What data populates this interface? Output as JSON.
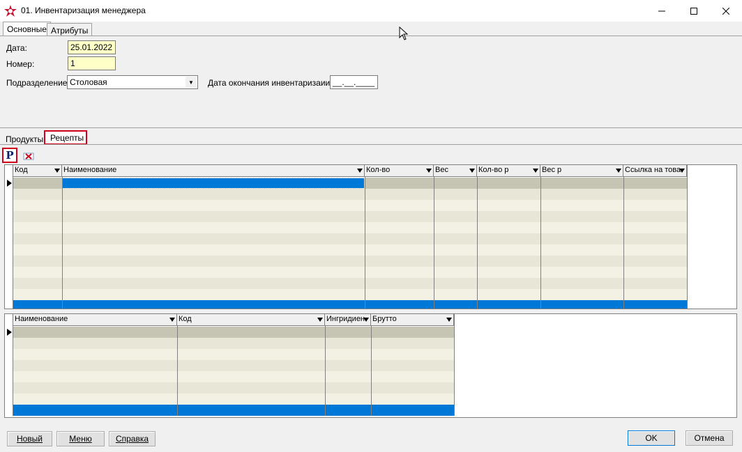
{
  "window": {
    "title": "01. Инвентаризация менеджера"
  },
  "top_tabs": [
    "Основные",
    "Атрибуты"
  ],
  "form": {
    "date_label": "Дата:",
    "date_value": "25.01.2022",
    "number_label": "Номер:",
    "number_value": "1",
    "division_label": "Подразделение:",
    "division_value": "Столовая",
    "end_date_label": "Дата окончания инвентаризаии:",
    "end_date_value": "__.__.____"
  },
  "bottom_tabs": [
    "Продукты",
    "Рецепты"
  ],
  "toolbar": {
    "recipe_button": "P"
  },
  "grid1": {
    "columns": [
      "Код",
      "Наименование",
      "Кол-во",
      "Вес",
      "Кол-во р",
      "Вес р",
      "Ссылка на това"
    ]
  },
  "grid2": {
    "columns": [
      "Наименование",
      "Код",
      "Ингридиен",
      "Брутто"
    ]
  },
  "buttons": {
    "new": "Новый",
    "menu": "Меню",
    "help": "Справка",
    "ok": "OK",
    "cancel": "Отмена"
  },
  "colors": {
    "selection": "#0078d7",
    "row_even": "#f3f1e4",
    "row_odd": "#e8e6d6",
    "current_row": "#c6c4b2",
    "highlight": "#d0021b"
  }
}
